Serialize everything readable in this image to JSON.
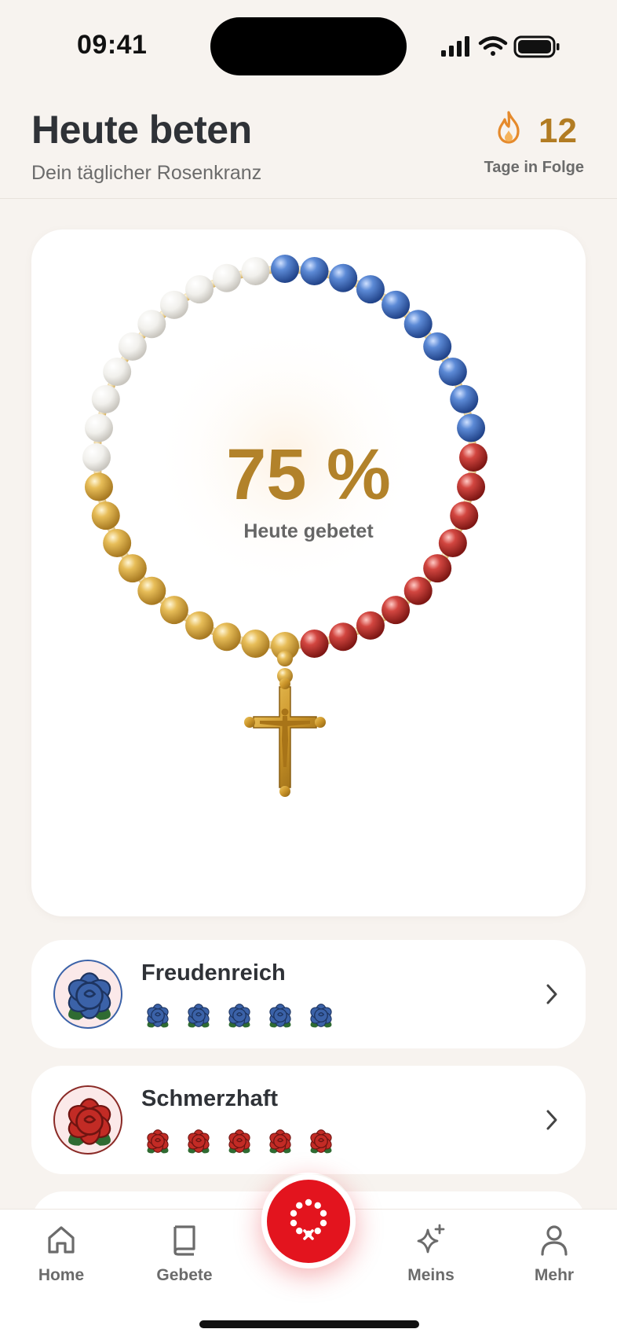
{
  "status_bar": {
    "time": "09:41",
    "icons": [
      "cellular-signal-icon",
      "wifi-icon",
      "battery-icon"
    ]
  },
  "header": {
    "title": "Heute beten",
    "subtitle": "Dein täglicher Rosenkranz",
    "streak": {
      "icon": "flame-icon",
      "count": "12",
      "label": "Tage in Folge"
    }
  },
  "rosary": {
    "percent_text": "75 %",
    "percent_value": 75,
    "label": "Heute gebetet",
    "bead_groups": [
      {
        "mystery": "Freudenreich",
        "color": "#3f6fc0",
        "count": 10
      },
      {
        "mystery": "Schmerzhaft",
        "color": "#c0302b",
        "count": 10
      },
      {
        "mystery": "gold",
        "color": "#ddb24c",
        "count": 10
      },
      {
        "mystery": "white",
        "color": "#f1f0ec",
        "count": 10
      }
    ]
  },
  "mysteries": [
    {
      "name": "Freudenreich",
      "color": "#3b62a8",
      "icon": "blue-rose-icon",
      "roses": 5
    },
    {
      "name": "Schmerzhaft",
      "color": "#c22b25",
      "icon": "red-rose-icon",
      "roses": 5
    }
  ],
  "tab_bar": {
    "tabs": [
      {
        "label": "Home",
        "icon": "home-icon"
      },
      {
        "label": "Gebete",
        "icon": "book-icon"
      },
      {
        "label": "Meins",
        "icon": "sparkle-icon"
      },
      {
        "label": "Mehr",
        "icon": "person-icon"
      }
    ],
    "center_button_icon": "rosary-icon",
    "accent": "#e3141e"
  }
}
